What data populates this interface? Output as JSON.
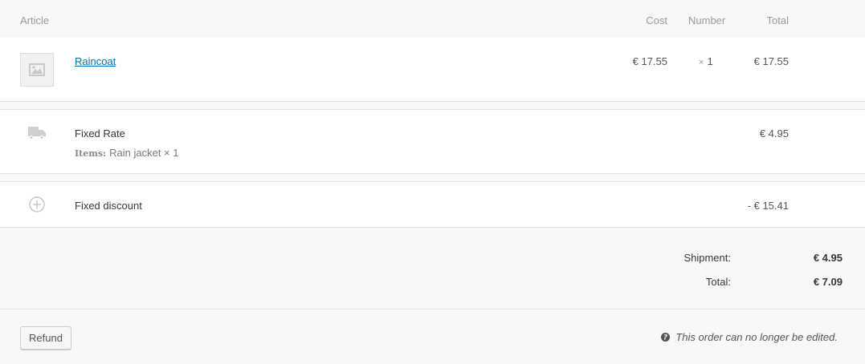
{
  "header": {
    "article": "Article",
    "cost": "Cost",
    "number": "Number",
    "total": "Total"
  },
  "item": {
    "thumb_icon": "image-placeholder-icon",
    "name": "Raincoat",
    "cost": "€ 17.55",
    "qty_x": "×",
    "qty": "1",
    "total": "€ 17.55"
  },
  "shipping": {
    "icon": "truck-icon",
    "name": "Fixed Rate",
    "meta_label": "Items:",
    "meta_value": "Rain jacket × 1",
    "total": "€ 4.95"
  },
  "fee": {
    "icon": "plus-circle-icon",
    "name": "Fixed discount",
    "total": "- € 15.41"
  },
  "totals": {
    "shipment_label": "Shipment:",
    "shipment_value": "€ 4.95",
    "total_label": "Total:",
    "total_value": "€ 7.09"
  },
  "actions": {
    "refund_label": "Refund",
    "locked_icon": "help-icon",
    "locked_text": "This order can no longer be edited."
  }
}
